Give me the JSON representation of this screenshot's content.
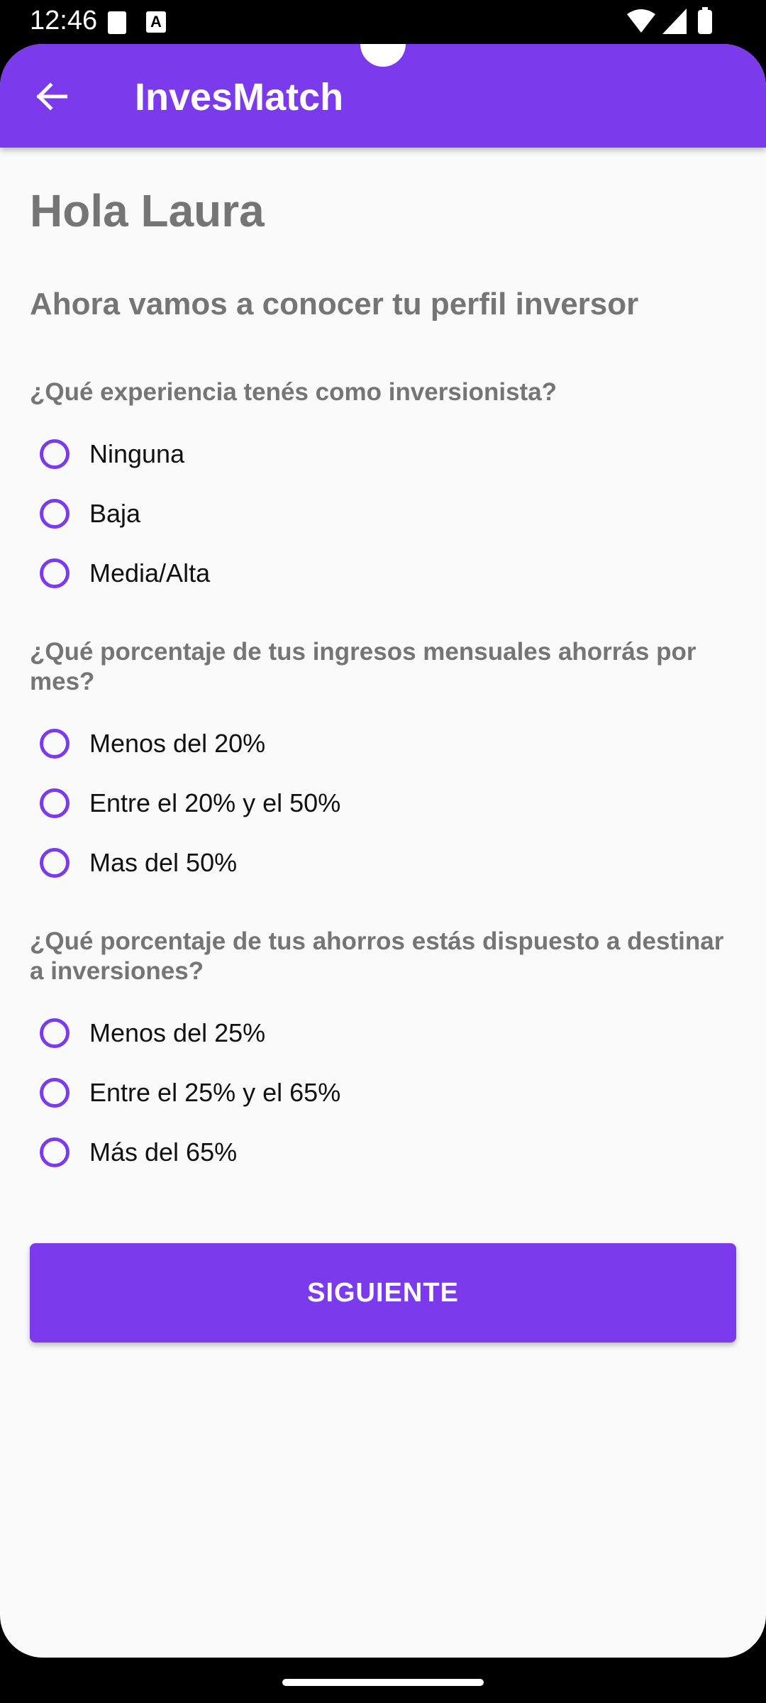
{
  "status_bar": {
    "time": "12:46",
    "notification_letter": "A"
  },
  "app_bar": {
    "title": "InvesMatch"
  },
  "greeting": "Hola Laura",
  "subtitle": "Ahora vamos a conocer tu perfil inversor",
  "questions": [
    {
      "text": "¿Qué experiencia tenés como inversionista?",
      "options": [
        "Ninguna",
        "Baja",
        "Media/Alta"
      ]
    },
    {
      "text": "¿Qué porcentaje de tus ingresos mensuales ahorrás por mes?",
      "options": [
        "Menos del 20%",
        "Entre el 20% y el 50%",
        "Mas del 50%"
      ]
    },
    {
      "text": "¿Qué porcentaje de tus ahorros estás dispuesto a destinar a inversiones?",
      "options": [
        "Menos del 25%",
        "Entre el 25% y el 65%",
        "Más del 65%"
      ]
    }
  ],
  "next_button": {
    "label": "SIGUIENTE"
  },
  "colors": {
    "accent": "#7c3aed",
    "background": "#fafafa",
    "muted_text": "#757575"
  }
}
